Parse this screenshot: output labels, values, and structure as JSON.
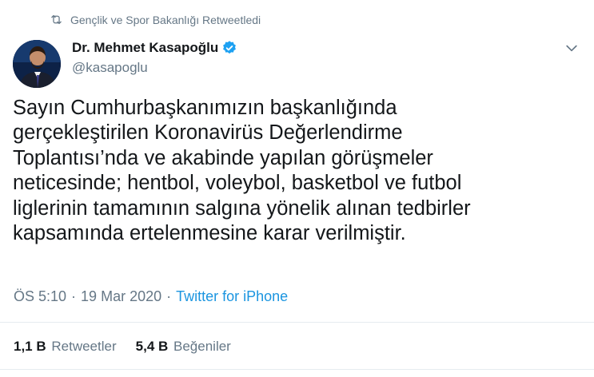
{
  "retweet": {
    "label": "Gençlik ve Spor Bakanlığı Retweetledi",
    "icon": "retweet-icon"
  },
  "author": {
    "name": "Dr. Mehmet Kasapoğlu",
    "handle": "@kasapoglu",
    "verified_icon": "verified-badge-icon"
  },
  "tweet": {
    "text": "Sayın Cumhurbaşkanımızın başkanlığında\ngerçekleştirilen Koronavirüs Değerlendirme\nToplantısı’nda ve akabinde yapılan görüşmeler\nneticesinde; hentbol, voleybol, basketbol ve futbol\nliglerinin tamamının salgına yönelik alınan tedbirler\nkapsamında ertelenmesine karar verilmiştir.",
    "time": "ÖS 5:10",
    "date": "19 Mar 2020",
    "separator": "·",
    "source": "Twitter for iPhone"
  },
  "stats": {
    "retweets": {
      "count": "1,1 B",
      "label": "Retweetler"
    },
    "likes": {
      "count": "5,4 B",
      "label": "Beğeniler"
    }
  },
  "colors": {
    "link": "#1b95e0",
    "muted": "#657786",
    "divider": "#e6ecf0",
    "verified": "#1da1f2"
  }
}
